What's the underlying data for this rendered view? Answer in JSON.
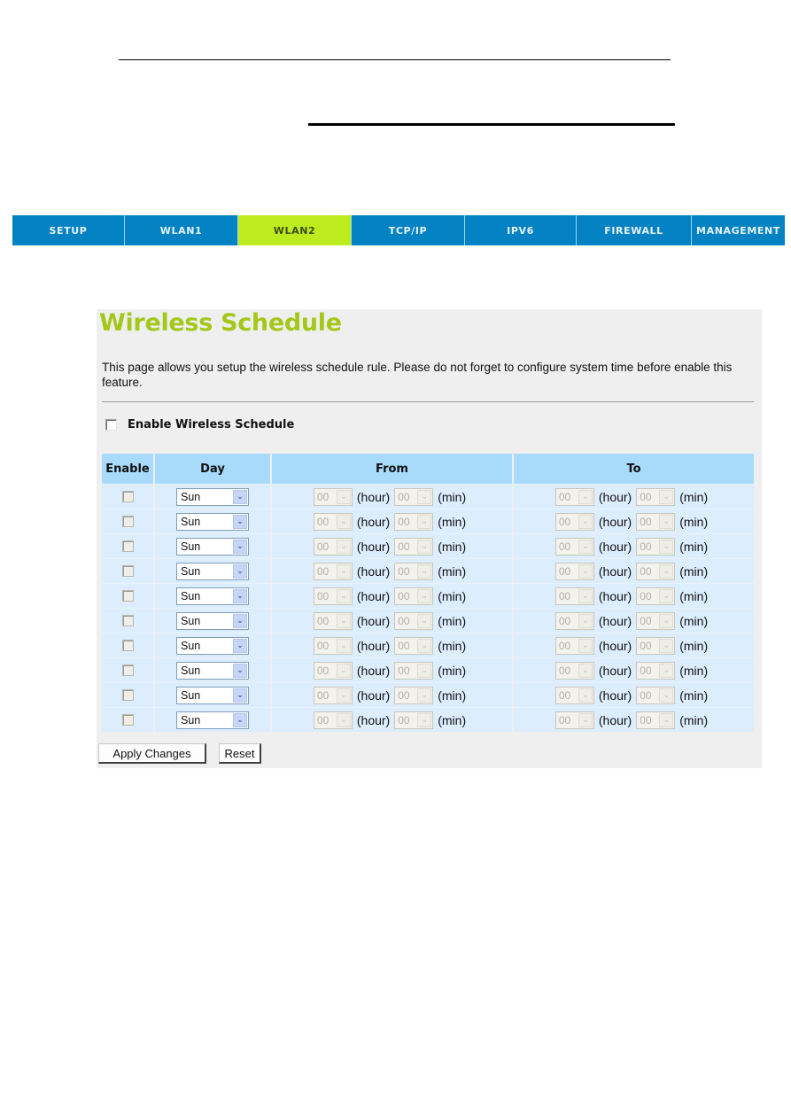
{
  "nav": {
    "tabs": [
      {
        "label": "SETUP",
        "active": false
      },
      {
        "label": "WLAN1",
        "active": false
      },
      {
        "label": "WLAN2",
        "active": true
      },
      {
        "label": "TCP/IP",
        "active": false
      },
      {
        "label": "IPV6",
        "active": false
      },
      {
        "label": "FIREWALL",
        "active": false
      },
      {
        "label": "MANAGEMENT",
        "active": false
      }
    ]
  },
  "page": {
    "title": "Wireless Schedule",
    "description": "This page allows you setup the wireless schedule rule. Please do not forget to configure system time before enable this feature.",
    "enable_label": "Enable Wireless Schedule",
    "enable_checked": false
  },
  "table": {
    "headers": {
      "enable": "Enable",
      "day": "Day",
      "from": "From",
      "to": "To"
    },
    "unit_hour": "(hour)",
    "unit_min": "(min)",
    "rows": [
      {
        "enabled": false,
        "day": "Sun",
        "from_hour": "00",
        "from_min": "00",
        "to_hour": "00",
        "to_min": "00"
      },
      {
        "enabled": false,
        "day": "Sun",
        "from_hour": "00",
        "from_min": "00",
        "to_hour": "00",
        "to_min": "00"
      },
      {
        "enabled": false,
        "day": "Sun",
        "from_hour": "00",
        "from_min": "00",
        "to_hour": "00",
        "to_min": "00"
      },
      {
        "enabled": false,
        "day": "Sun",
        "from_hour": "00",
        "from_min": "00",
        "to_hour": "00",
        "to_min": "00"
      },
      {
        "enabled": false,
        "day": "Sun",
        "from_hour": "00",
        "from_min": "00",
        "to_hour": "00",
        "to_min": "00"
      },
      {
        "enabled": false,
        "day": "Sun",
        "from_hour": "00",
        "from_min": "00",
        "to_hour": "00",
        "to_min": "00"
      },
      {
        "enabled": false,
        "day": "Sun",
        "from_hour": "00",
        "from_min": "00",
        "to_hour": "00",
        "to_min": "00"
      },
      {
        "enabled": false,
        "day": "Sun",
        "from_hour": "00",
        "from_min": "00",
        "to_hour": "00",
        "to_min": "00"
      },
      {
        "enabled": false,
        "day": "Sun",
        "from_hour": "00",
        "from_min": "00",
        "to_hour": "00",
        "to_min": "00"
      },
      {
        "enabled": false,
        "day": "Sun",
        "from_hour": "00",
        "from_min": "00",
        "to_hour": "00",
        "to_min": "00"
      }
    ]
  },
  "buttons": {
    "apply": "Apply Changes",
    "reset": "Reset"
  },
  "colors": {
    "nav_bg": "#0282c3",
    "nav_active": "#bdec1e",
    "title": "#a5c71a",
    "table_header": "#a8dbfb",
    "table_row": "#dcedfd",
    "panel_bg": "#efefef"
  }
}
